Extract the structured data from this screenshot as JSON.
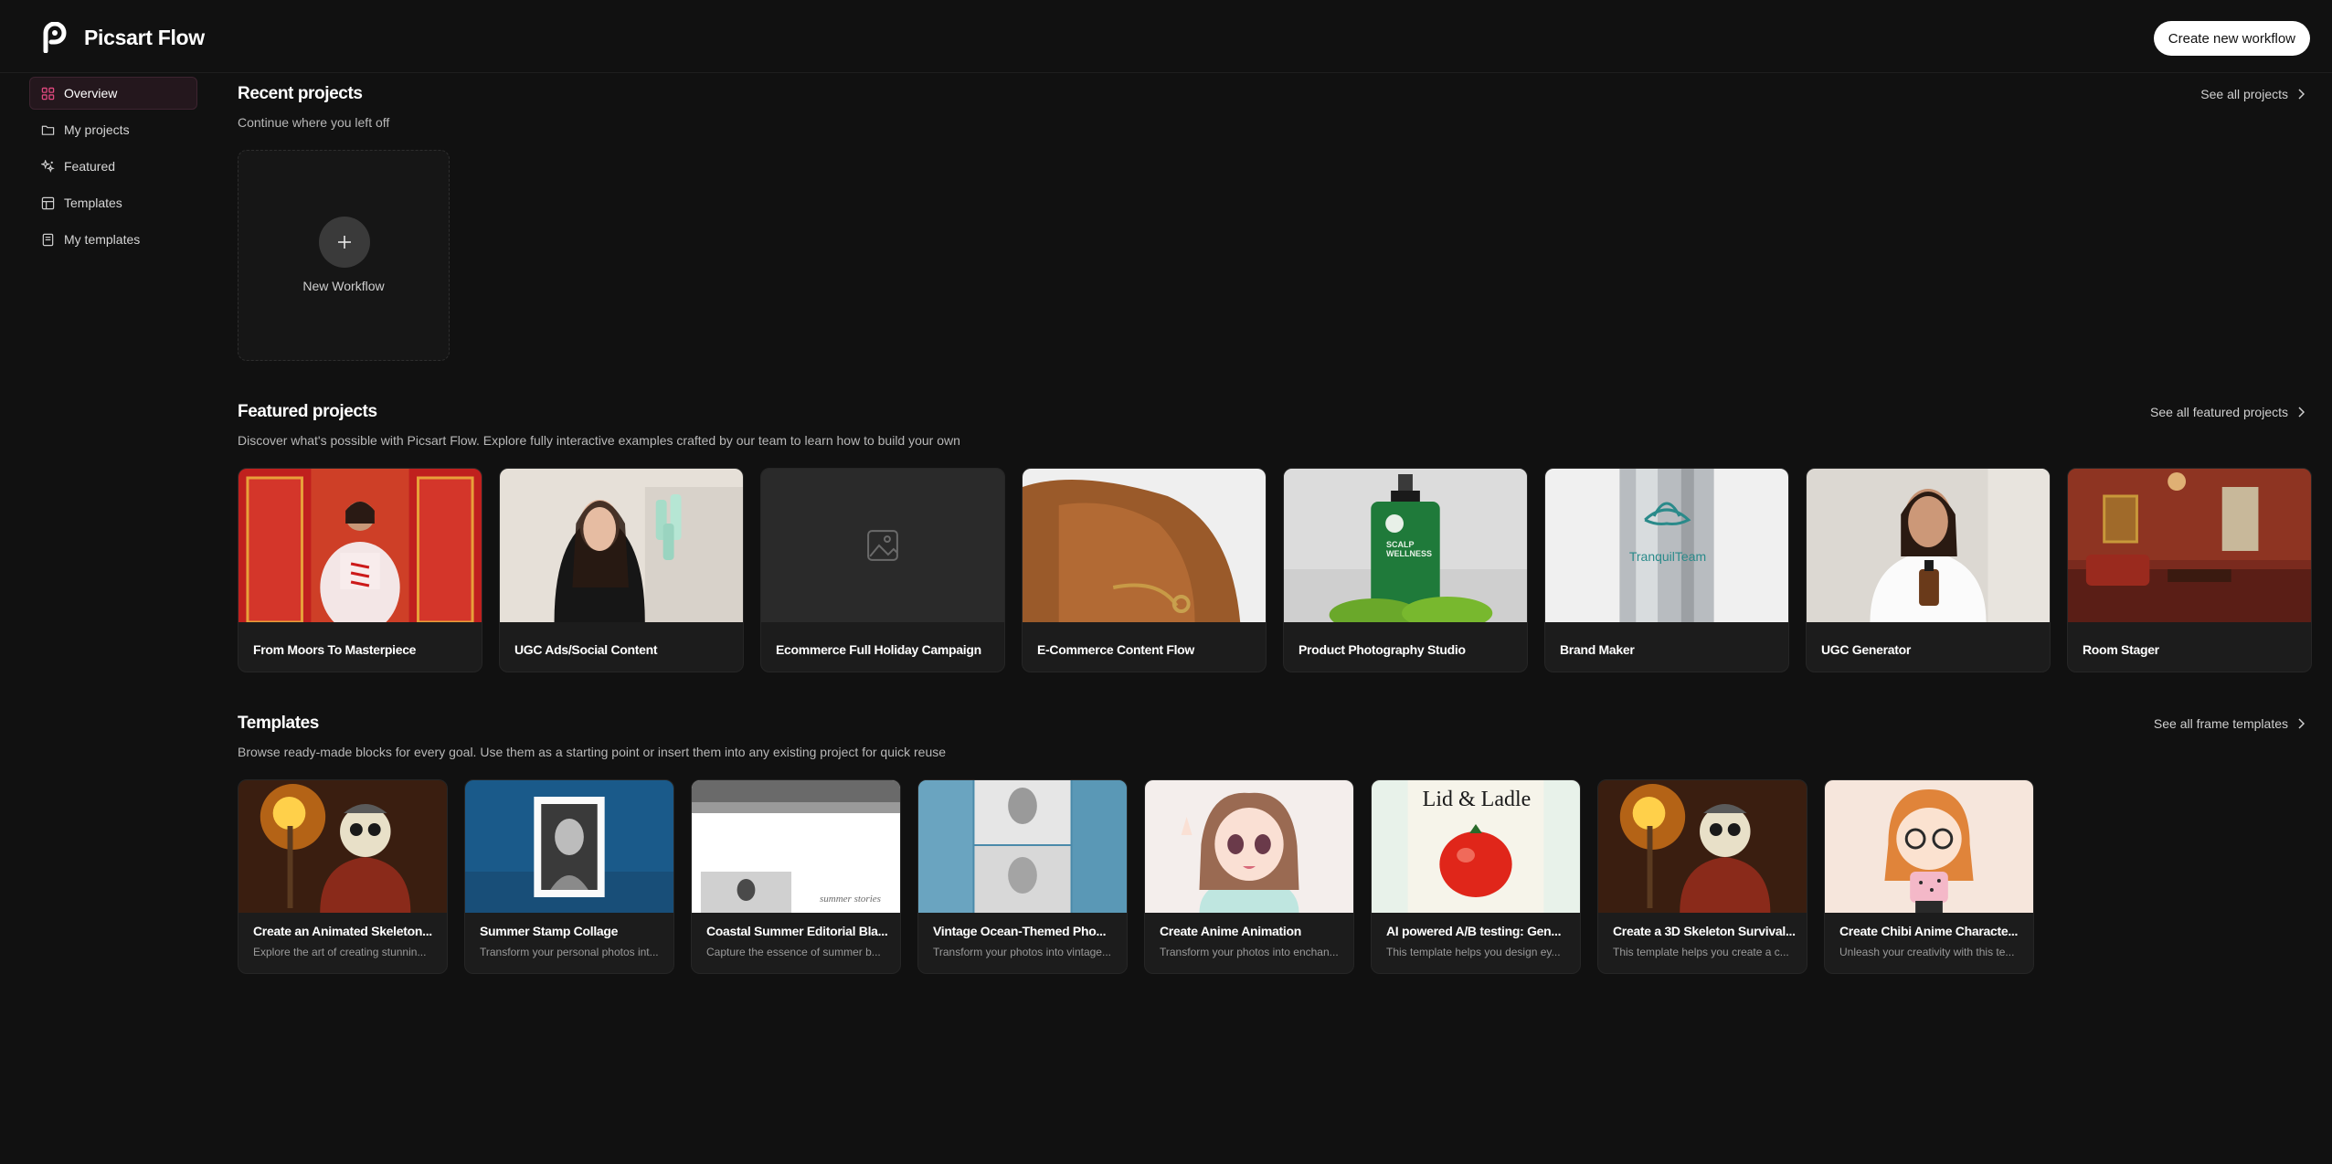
{
  "app": {
    "name": "Picsart Flow",
    "create_button": "Create new workflow"
  },
  "sidebar": {
    "items": [
      {
        "label": "Overview",
        "icon": "grid-icon",
        "active": true
      },
      {
        "label": "My projects",
        "icon": "folder-icon",
        "active": false
      },
      {
        "label": "Featured",
        "icon": "sparkle-icon",
        "active": false
      },
      {
        "label": "Templates",
        "icon": "template-icon",
        "active": false
      },
      {
        "label": "My templates",
        "icon": "bookmark-icon",
        "active": false
      }
    ]
  },
  "recent": {
    "title": "Recent projects",
    "subtitle": "Continue where you left off",
    "see_all": "See all projects",
    "new_workflow_label": "New Workflow"
  },
  "featured": {
    "title": "Featured projects",
    "subtitle": "Discover what's possible with Picsart Flow. Explore fully interactive examples crafted by our team to learn how to build your own",
    "see_all": "See all featured projects",
    "items": [
      {
        "label": "From Moors To Masterpiece"
      },
      {
        "label": "UGC Ads/Social Content"
      },
      {
        "label": "Ecommerce Full Holiday Campaign"
      },
      {
        "label": "E-Commerce Content Flow"
      },
      {
        "label": "Product Photography Studio"
      },
      {
        "label": "Brand Maker"
      },
      {
        "label": "UGC Generator"
      },
      {
        "label": "Room Stager"
      }
    ]
  },
  "templates": {
    "title": "Templates",
    "subtitle": "Browse ready-made blocks for every goal. Use them as a starting point or insert them into any existing project for quick reuse",
    "see_all": "See all frame templates",
    "items": [
      {
        "title": "Create an Animated Skeleton...",
        "desc": "Explore the art of creating stunnin..."
      },
      {
        "title": "Summer Stamp Collage",
        "desc": "Transform your personal photos int..."
      },
      {
        "title": "Coastal Summer Editorial Bla...",
        "desc": "Capture the essence of summer b..."
      },
      {
        "title": "Vintage Ocean-Themed Pho...",
        "desc": "Transform your photos into vintage..."
      },
      {
        "title": "Create Anime Animation",
        "desc": "Transform your photos into enchan..."
      },
      {
        "title": "AI powered A/B testing: Gen...",
        "desc": "This template helps you design ey..."
      },
      {
        "title": "Create a 3D Skeleton Survival...",
        "desc": "This template helps you create a c..."
      },
      {
        "title": "Create Chibi Anime Characte...",
        "desc": "Unleash your creativity with this te..."
      }
    ]
  },
  "thumb_text": {
    "brand_maker": "TranquilTeam",
    "wellness": "SCALP WELLNESS",
    "lid": "Lid & Ladle",
    "summer": "summer stories"
  },
  "colors": {
    "accent_active_bg": "#24171d",
    "background": "#111111",
    "card": "#1c1c1c"
  }
}
